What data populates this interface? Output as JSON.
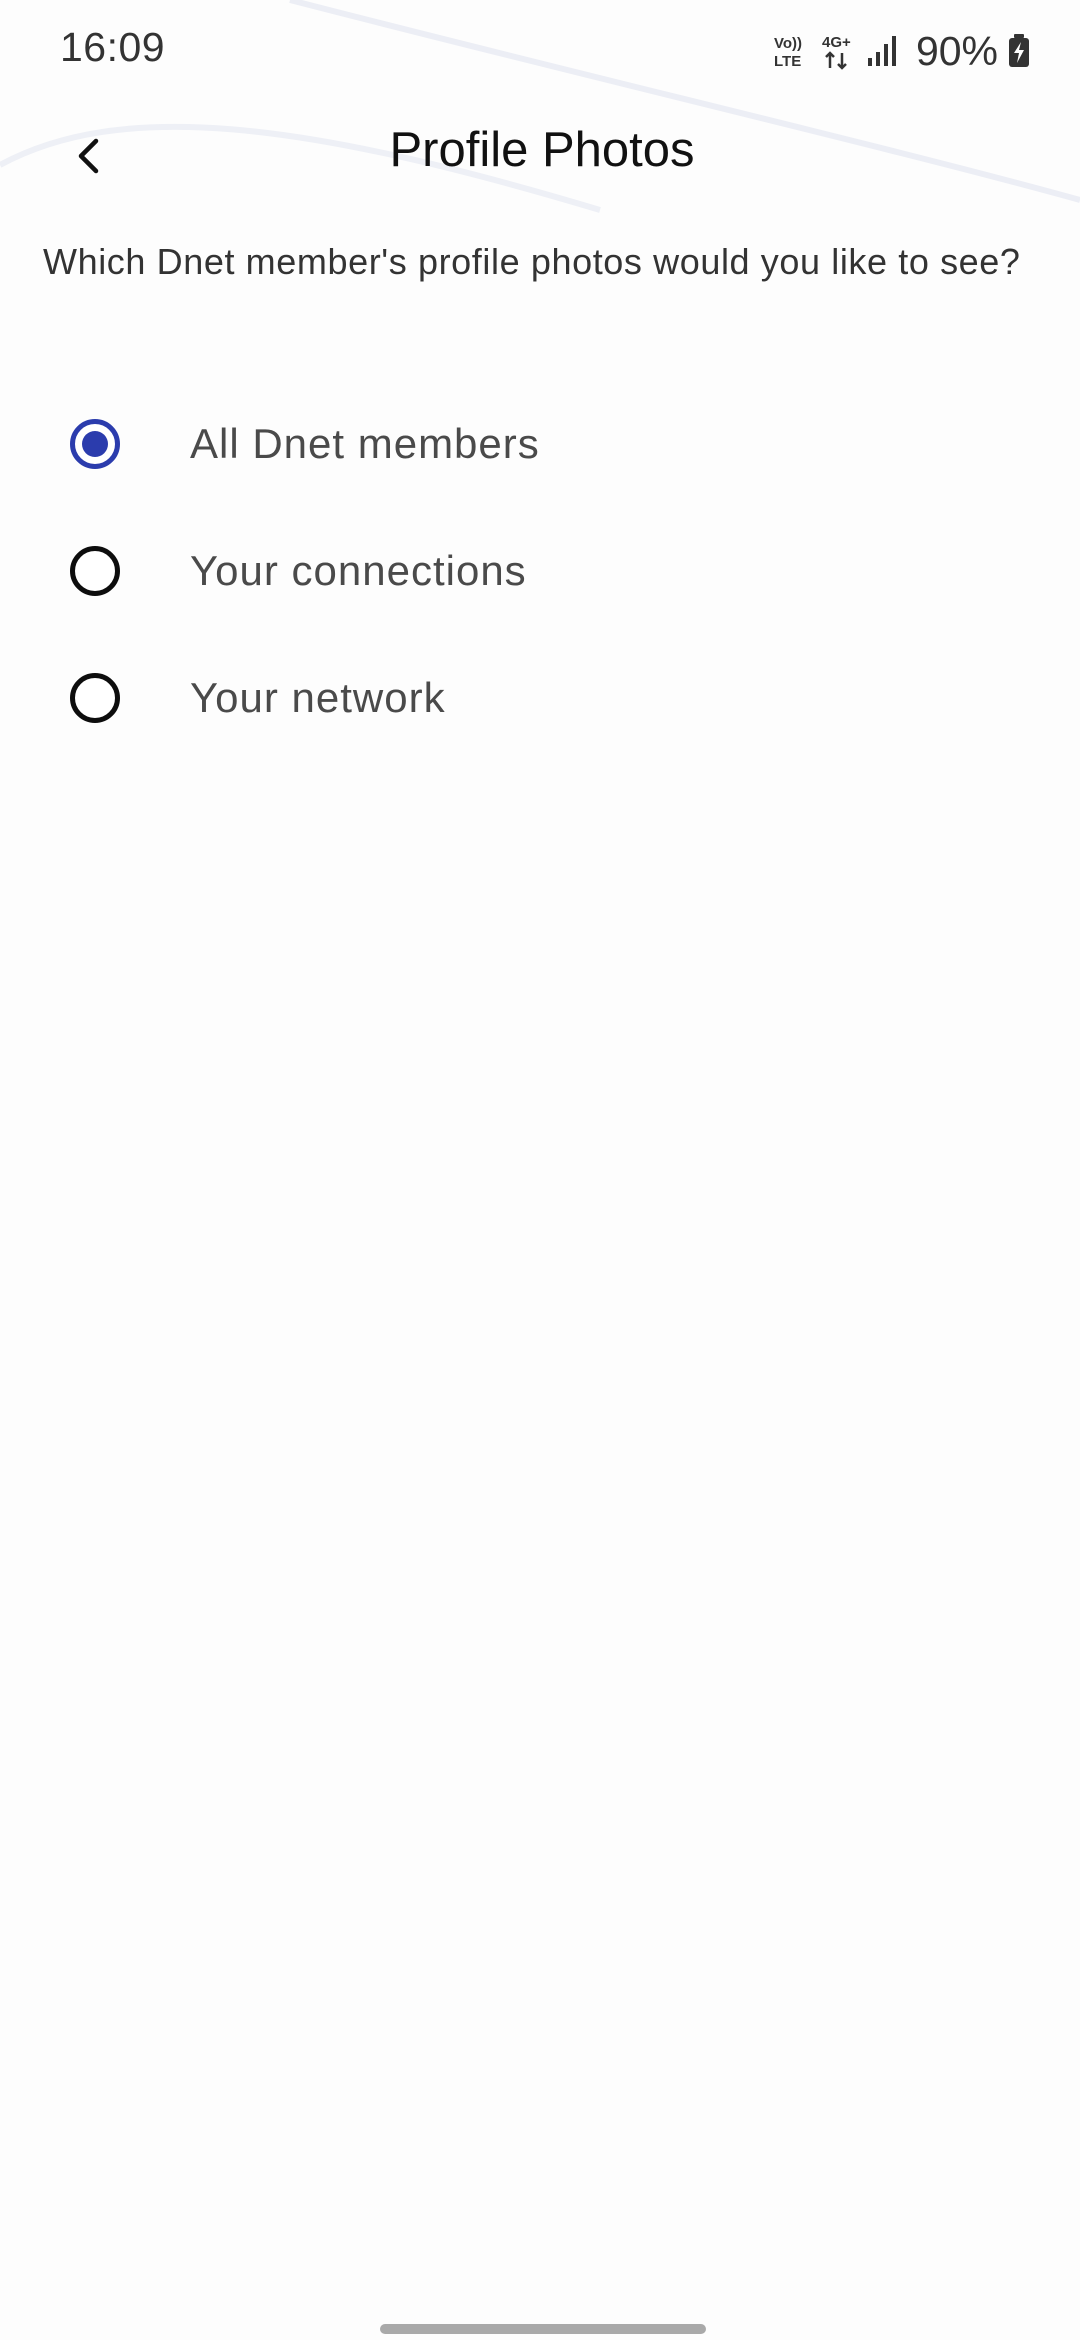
{
  "status_bar": {
    "time": "16:09",
    "volte_label_top": "Vo))",
    "volte_label_bottom": "LTE",
    "network_type": "4G+",
    "battery_percent": "90%",
    "icons": [
      "volte-icon",
      "4g-plus-icon",
      "signal-icon",
      "battery-charging-icon"
    ]
  },
  "header": {
    "back_icon": "chevron-left-icon",
    "title": "Profile Photos"
  },
  "description": "Which Dnet member's profile photos would you like to see?",
  "options": [
    {
      "label": "All Dnet members",
      "selected": true
    },
    {
      "label": "Your connections",
      "selected": false
    },
    {
      "label": "Your network",
      "selected": false
    }
  ],
  "colors": {
    "accent": "#2b3cad",
    "radio_unselected": "#0d0d0d",
    "label_text": "#4a4a4a",
    "title_text": "#111111",
    "background": "#fdfdfd"
  }
}
